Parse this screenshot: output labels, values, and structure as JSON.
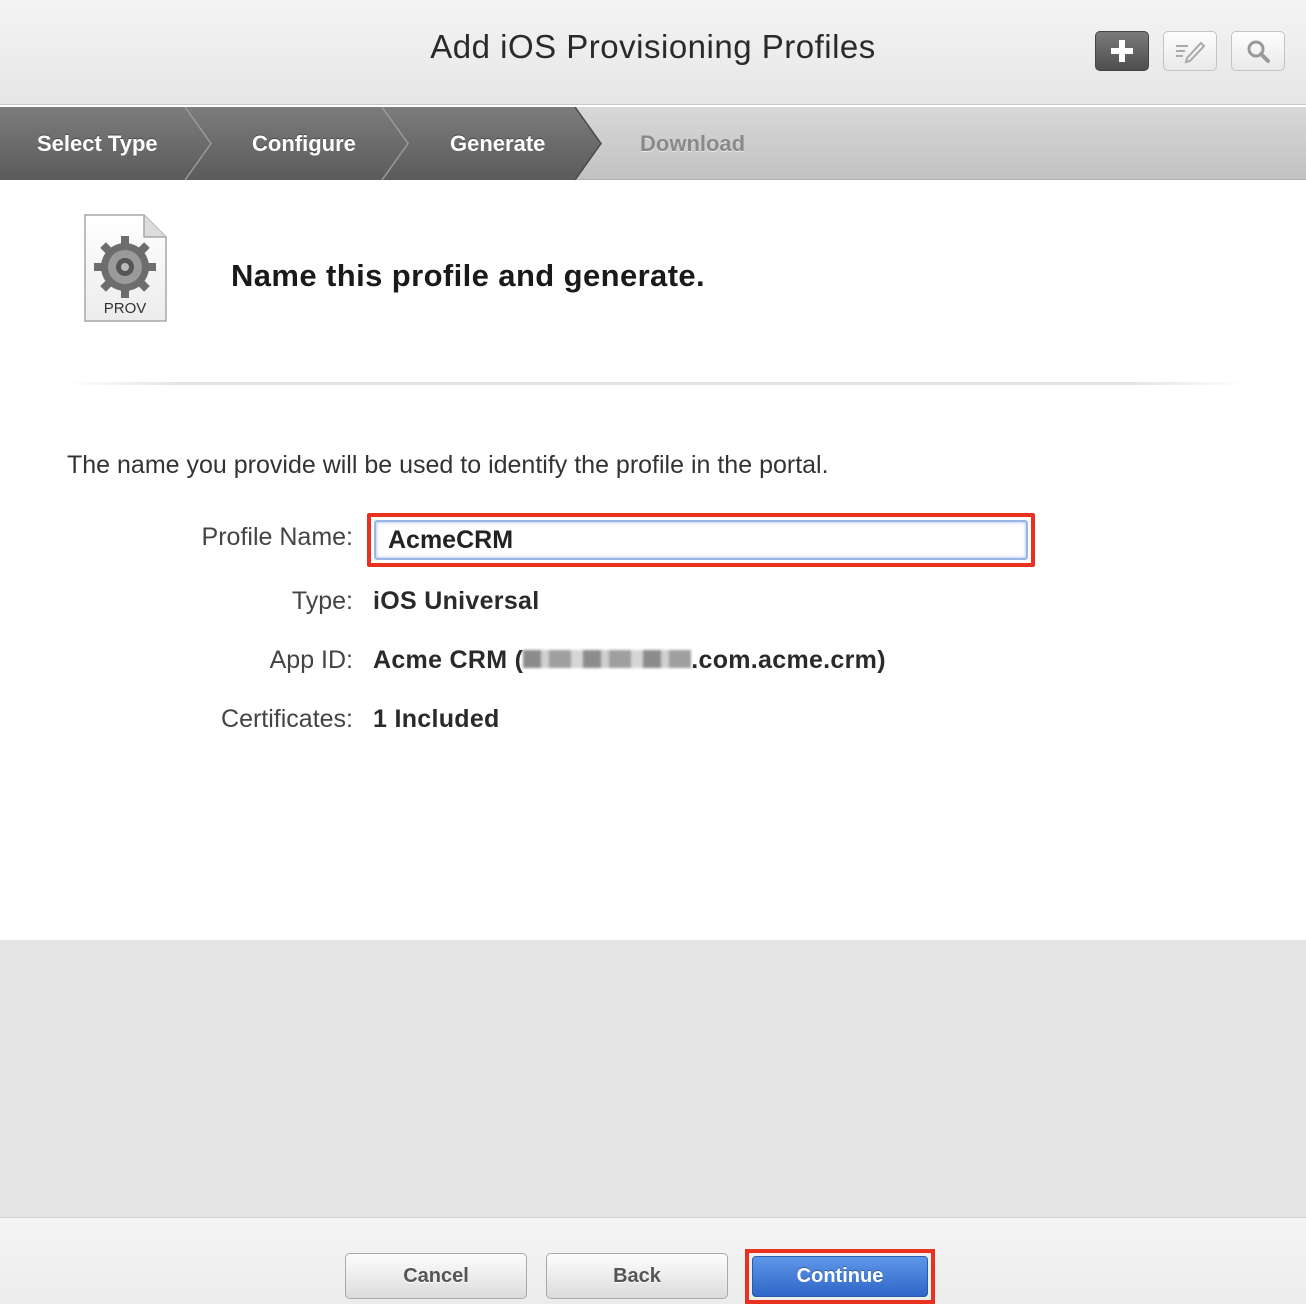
{
  "header": {
    "title": "Add iOS Provisioning Profiles",
    "buttons": [
      {
        "name": "add-button",
        "icon": "plus-icon"
      },
      {
        "name": "edit-button",
        "icon": "edit-icon"
      },
      {
        "name": "search-button",
        "icon": "search-icon"
      }
    ]
  },
  "steps": [
    {
      "label": "Select Type",
      "status": "complete"
    },
    {
      "label": "Configure",
      "status": "complete"
    },
    {
      "label": "Generate",
      "status": "current"
    },
    {
      "label": "Download",
      "status": "pending"
    }
  ],
  "content": {
    "icon_label": "PROV",
    "heading": "Name this profile and generate.",
    "intro": "The name you provide will be used to identify the profile in the portal.",
    "fields": {
      "profile_name_label": "Profile Name:",
      "profile_name_value": "AcmeCRM",
      "type_label": "Type:",
      "type_value": "iOS Universal",
      "app_id_label": "App ID:",
      "app_id_prefix": "Acme CRM (",
      "app_id_suffix": ".com.acme.crm)",
      "certificates_label": "Certificates:",
      "certificates_value": "1 Included"
    }
  },
  "footer": {
    "cancel_label": "Cancel",
    "back_label": "Back",
    "continue_label": "Continue"
  },
  "colors": {
    "highlight": "#e8321f",
    "primary_button": "#2f66c8"
  }
}
